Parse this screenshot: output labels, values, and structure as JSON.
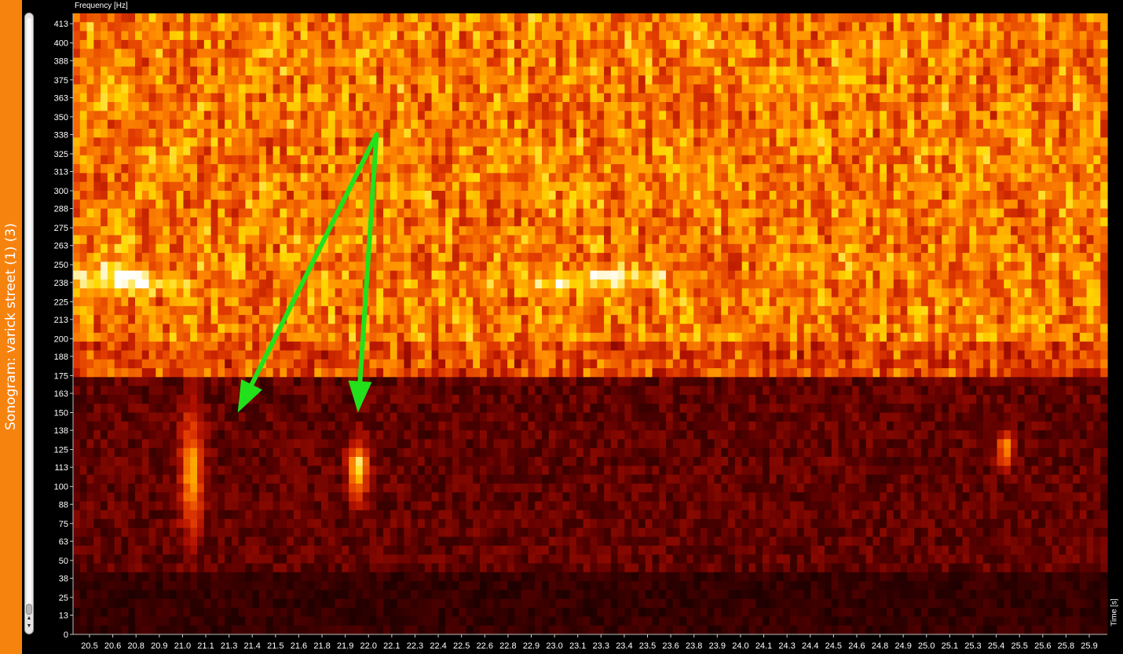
{
  "window": {
    "side_tab_label": "Sonogram: varick street (1) (3)"
  },
  "chart_data": {
    "type": "heatmap",
    "ylabel": "Frequency [Hz]",
    "xlabel": "Time [s]",
    "y_ticks": [
      "413",
      "400",
      "388",
      "375",
      "363",
      "350",
      "338",
      "325",
      "313",
      "300",
      "288",
      "275",
      "263",
      "250",
      "238",
      "225",
      "213",
      "200",
      "188",
      "175",
      "163",
      "150",
      "138",
      "125",
      "113",
      "100",
      "88",
      "75",
      "63",
      "50",
      "38",
      "25",
      "13",
      "0"
    ],
    "x_ticks": [
      "20.5",
      "20.6",
      "20.8",
      "20.9",
      "21.0",
      "21.1",
      "21.3",
      "21.4",
      "21.5",
      "21.6",
      "21.8",
      "21.9",
      "22.0",
      "22.1",
      "22.3",
      "22.4",
      "22.5",
      "22.6",
      "22.8",
      "22.9",
      "23.0",
      "23.1",
      "23.3",
      "23.4",
      "23.5",
      "23.6",
      "23.8",
      "23.9",
      "24.0",
      "24.1",
      "24.3",
      "24.4",
      "24.5",
      "24.6",
      "24.8",
      "24.9",
      "25.0",
      "25.1",
      "25.3",
      "25.4",
      "25.5",
      "25.6",
      "25.8",
      "25.9"
    ],
    "colormap": [
      "#000000",
      "#5a0000",
      "#b01000",
      "#e23c00",
      "#ff8a00",
      "#ffd800",
      "#ffffff"
    ],
    "band_boundary_hz": 175,
    "annotations": {
      "arrow_color": "#22e01a",
      "arrow_targets_time_s": [
        21.3,
        21.95
      ],
      "arrow_source_time_s": 22.05,
      "arrow_source_hz": 338,
      "arrow_target_hz": 150
    }
  }
}
